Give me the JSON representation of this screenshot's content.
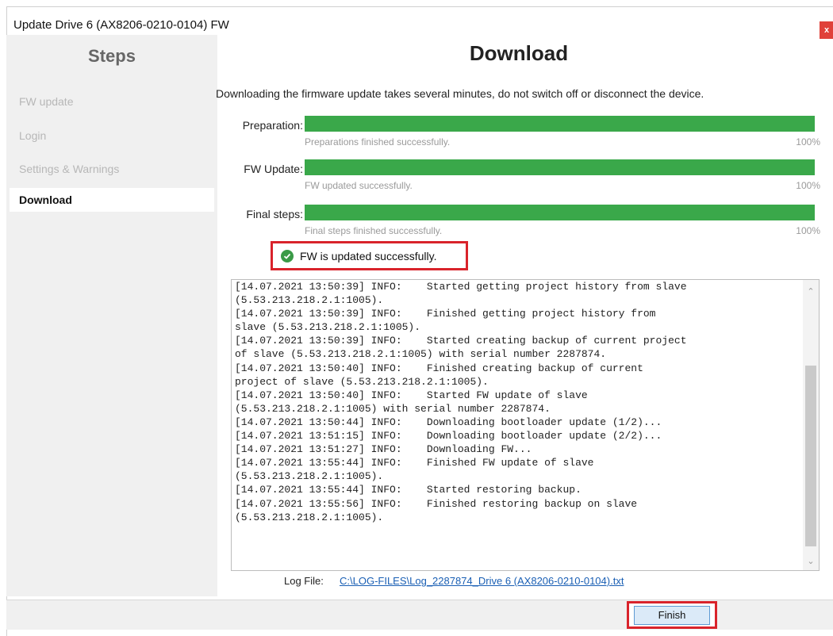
{
  "window": {
    "title": "Update Drive 6 (AX8206-0210-0104) FW",
    "close_label": "x"
  },
  "sidebar": {
    "title": "Steps",
    "items": [
      {
        "label": "FW update",
        "active": false
      },
      {
        "label": "Login",
        "active": false
      },
      {
        "label": "Settings & Warnings",
        "active": false
      },
      {
        "label": "Download",
        "active": true
      }
    ]
  },
  "main": {
    "title": "Download",
    "description": "Downloading the firmware update takes several minutes, do not switch off or disconnect the device.",
    "progress": [
      {
        "label": "Preparation:",
        "status": "Preparations finished successfully.",
        "percent_label": "100%",
        "value": 100
      },
      {
        "label": "FW Update:",
        "status": "FW updated successfully.",
        "percent_label": "100%",
        "value": 100
      },
      {
        "label": "Final steps:",
        "status": "Final steps finished successfully.",
        "percent_label": "100%",
        "value": 100
      }
    ],
    "success_message": "FW is updated successfully.",
    "log_lines": [
      "[14.07.2021 13:50:39] INFO:    Started getting project history from slave",
      "(5.53.213.218.2.1:1005).",
      "[14.07.2021 13:50:39] INFO:    Finished getting project history from",
      "slave (5.53.213.218.2.1:1005).",
      "[14.07.2021 13:50:39] INFO:    Started creating backup of current project",
      "of slave (5.53.213.218.2.1:1005) with serial number 2287874.",
      "[14.07.2021 13:50:40] INFO:    Finished creating backup of current",
      "project of slave (5.53.213.218.2.1:1005).",
      "[14.07.2021 13:50:40] INFO:    Started FW update of slave",
      "(5.53.213.218.2.1:1005) with serial number 2287874.",
      "[14.07.2021 13:50:44] INFO:    Downloading bootloader update (1/2)...",
      "[14.07.2021 13:51:15] INFO:    Downloading bootloader update (2/2)...",
      "[14.07.2021 13:51:27] INFO:    Downloading FW...",
      "[14.07.2021 13:55:44] INFO:    Finished FW update of slave",
      "(5.53.213.218.2.1:1005).",
      "[14.07.2021 13:55:44] INFO:    Started restoring backup.",
      "[14.07.2021 13:55:56] INFO:    Finished restoring backup on slave",
      "(5.53.213.218.2.1:1005)."
    ],
    "log_file_label": "Log File:",
    "log_file_path": "C:\\LOG-FILES\\Log_2287874_Drive 6 (AX8206-0210-0104).txt"
  },
  "footer": {
    "finish_label": "Finish"
  },
  "colors": {
    "progress_fill": "#3aa84a",
    "highlight_border": "#d9232b",
    "link": "#1a5fb4"
  }
}
